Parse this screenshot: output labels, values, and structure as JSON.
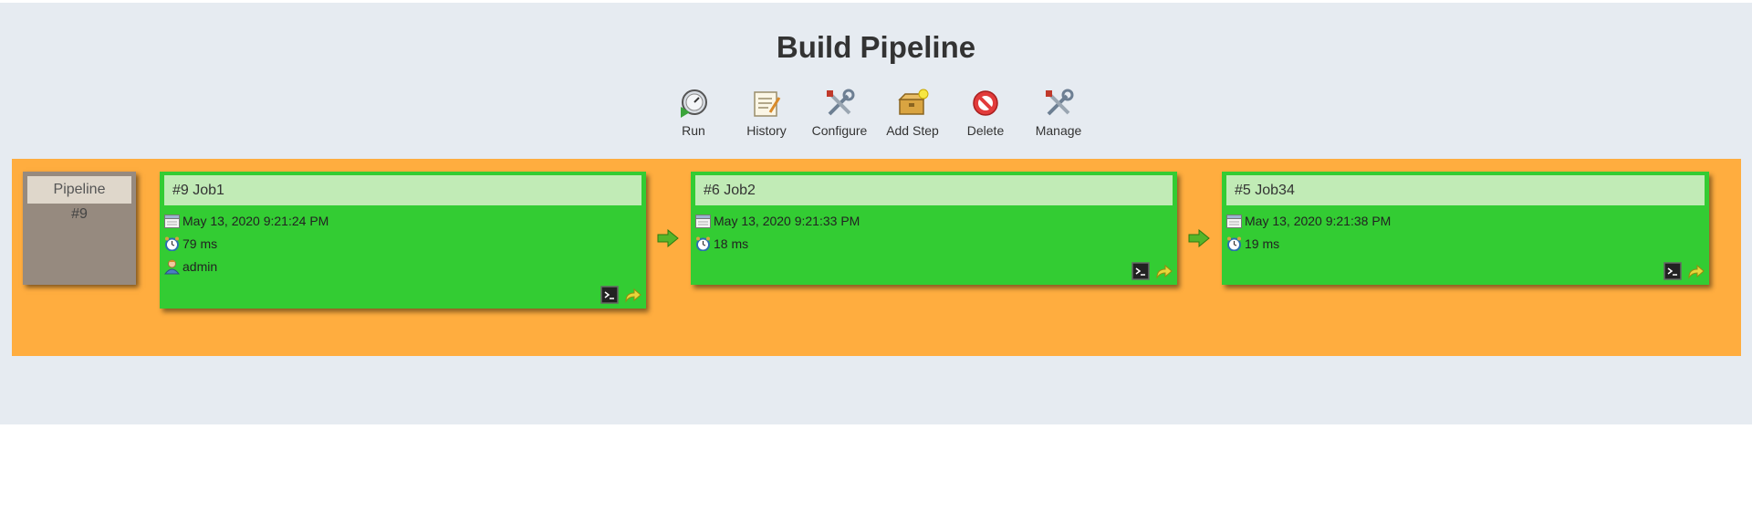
{
  "page": {
    "title": "Build Pipeline"
  },
  "toolbar": {
    "items": [
      {
        "label": "Run",
        "icon": "run-icon"
      },
      {
        "label": "History",
        "icon": "history-icon"
      },
      {
        "label": "Configure",
        "icon": "configure-icon"
      },
      {
        "label": "Add Step",
        "icon": "add-step-icon"
      },
      {
        "label": "Delete",
        "icon": "delete-icon"
      },
      {
        "label": "Manage",
        "icon": "manage-icon"
      }
    ]
  },
  "pipeline": {
    "label": "Pipeline",
    "number": "#9"
  },
  "jobs": [
    {
      "title": "#9 Job1",
      "timestamp": "May 13, 2020 9:21:24 PM",
      "duration": "79 ms",
      "user": "admin",
      "status": "success"
    },
    {
      "title": "#6 Job2",
      "timestamp": "May 13, 2020 9:21:33 PM",
      "duration": "18 ms",
      "status": "success"
    },
    {
      "title": "#5 Job34",
      "timestamp": "May 13, 2020 9:21:38 PM",
      "duration": "19 ms",
      "status": "success"
    }
  ],
  "colors": {
    "background": "#e6ebf1",
    "stage": "#ffad3f",
    "job_success": "#33cc33",
    "job_header": "#c1ebb6",
    "pipeline_box": "#968a7f"
  }
}
